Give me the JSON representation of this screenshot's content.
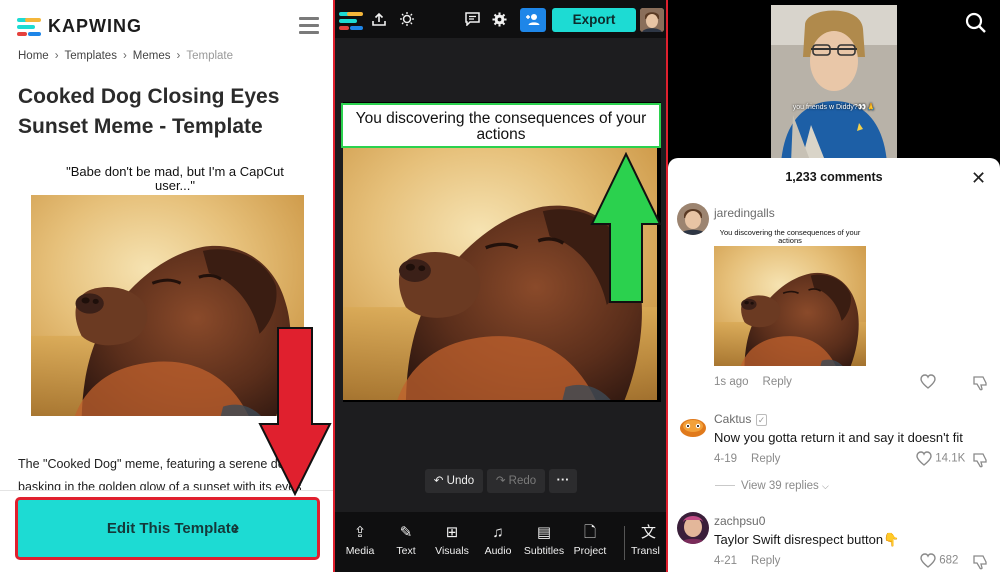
{
  "panel_kapwing": {
    "logo_text": "KAPWING",
    "brand_colors": [
      "#1ddbd3",
      "#f4b63a",
      "#e5413d",
      "#1e86e8"
    ],
    "breadcrumb": [
      "Home",
      "Templates",
      "Memes",
      "Template"
    ],
    "breadcrumb_sep": "›",
    "title": "Cooked Dog Closing Eyes Sunset Meme - Template",
    "meme_caption": "\"Babe don't be mad, but I'm a CapCut user...\"",
    "description": "The \"Cooked Dog\" meme, featuring a serene dog basking in the golden glow of a sunset with its eyes",
    "edit_button_label": "Edit This Template",
    "edit_button_icon": "chevron-right-icon",
    "arrow_color": "#e0202e"
  },
  "panel_editor": {
    "export_label": "Export",
    "text_overlay": "You discovering the consequences of your actions",
    "undo_label": "Undo",
    "redo_label": "Redo",
    "more_label": "···",
    "tools": [
      {
        "label": "Media",
        "icon": "media-upload-icon"
      },
      {
        "label": "Text",
        "icon": "text-edit-icon"
      },
      {
        "label": "Visuals",
        "icon": "visuals-grid-icon"
      },
      {
        "label": "Audio",
        "icon": "music-note-icon"
      },
      {
        "label": "Subtitles",
        "icon": "subtitles-icon"
      },
      {
        "label": "Project",
        "icon": "file-icon"
      },
      {
        "label": "Transl",
        "icon": "translate-icon"
      }
    ],
    "arrow_color": "#2bd14e",
    "accent_color": "#1ddbd3"
  },
  "panel_comments": {
    "video_caption": "you friends w Diddy?👀🙏",
    "comment_count": "1,233 comments",
    "comments": [
      {
        "username": "jaredingalls",
        "text": "",
        "image_caption": "You discovering the consequences of your actions",
        "time": "1s ago",
        "reply": "Reply",
        "likes": ""
      },
      {
        "username": "Caktus",
        "text": "Now you gotta return it and say it doesn't fit",
        "time": "4-19",
        "reply": "Reply",
        "likes": "14.1K",
        "view_replies": "View 39 replies"
      },
      {
        "username": "zachpsu0",
        "text": "Taylor Swift disrespect button👇",
        "time": "4-21",
        "reply": "Reply",
        "likes": "682"
      }
    ]
  }
}
